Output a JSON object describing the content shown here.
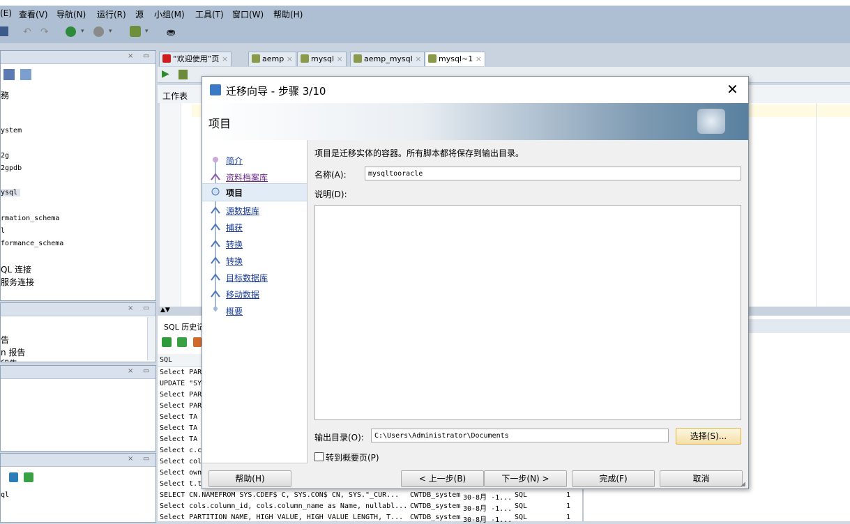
{
  "menu": [
    "(E)",
    "查看(V)",
    "导航(N)",
    "运行(R)",
    "源",
    "小组(M)",
    "工具(T)",
    "窗口(W)",
    "帮助(H)"
  ],
  "left_pane1": {
    "items": [
      "務",
      "ystem",
      "2g",
      "2gpdb",
      "ysql",
      "rmation_schema",
      "l",
      "formance_schema",
      "QL 连接",
      "服务连接"
    ]
  },
  "left_pane2": {
    "items": [
      "告",
      "n 报告",
      "印告"
    ]
  },
  "left_pane4": {
    "items": [
      "ql"
    ]
  },
  "tabs": [
    "“欢迎使用”页",
    "aemp",
    "mysql",
    "aemp_mysql",
    "mysql~1"
  ],
  "worksheet_label": "工作表",
  "history": {
    "title": "SQL 历史记",
    "column_sql": "SQL",
    "rows_short": [
      "Select PAR",
      "UPDATE \"SY",
      "Select PAR",
      "Select PAR",
      "Select  TA",
      "Select  TA",
      "Select  TA",
      "Select c.c",
      "Select col",
      "Select own",
      "Select t.t"
    ],
    "rows_full": [
      {
        "sql": "SELECT CN.NAMEFROM   SYS.CDEF$ C, SYS.CON$ CN, SYS.\"_CUR...",
        "conn": "CWTDB_system",
        "date": "30-8月 -1...",
        "type": "SQL",
        "count": "1"
      },
      {
        "sql": "Select cols.column_id, cols.column_name as Name, nullabl...",
        "conn": "CWTDB_system",
        "date": "30-8月 -1...",
        "type": "SQL",
        "count": "1"
      },
      {
        "sql": "Select PARTITION NAME,  HIGH VALUE, HIGH VALUE LENGTH, T...",
        "conn": "CWTDB_system",
        "date": "30-8月 -1...",
        "type": "SQL",
        "count": "1"
      }
    ]
  },
  "dialog": {
    "title": "迁移向导 - 步骤 3/10",
    "header": "项目",
    "steps": [
      "简介",
      "资料档案库",
      "项目",
      "源数据库",
      "捕获",
      "转换",
      "转换",
      "目标数据库",
      "移动数据",
      "概要"
    ],
    "current_step": 2,
    "description": "项目是迁移实体的容器。所有脚本都将保存到输出目录。",
    "name_label": "名称(A):",
    "name_value": "mysqltooracle",
    "desc_label": "说明(D):",
    "desc_value": "",
    "output_label": "输出目录(O):",
    "output_value": "C:\\Users\\Administrator\\Documents",
    "choose_btn": "选择(S)...",
    "checkbox_label": "转到概要页(P)",
    "checkbox_checked": false,
    "btn_help": "帮助(H)",
    "btn_prev": "< 上一步(B)",
    "btn_next": "下一步(N) >",
    "btn_finish": "完成(F)",
    "btn_cancel": "取消"
  }
}
